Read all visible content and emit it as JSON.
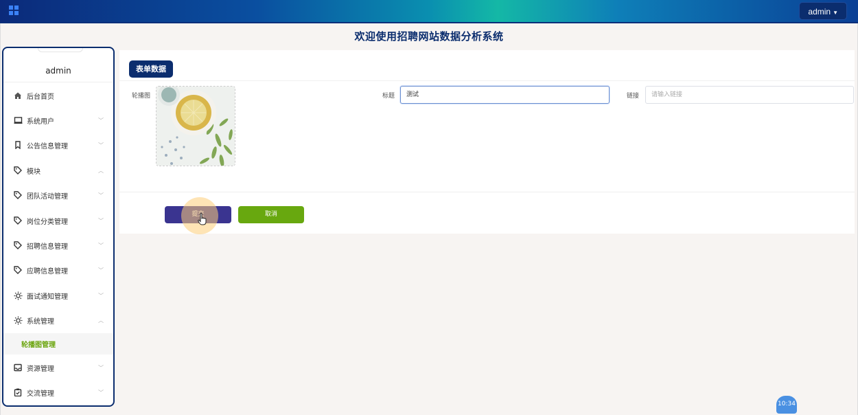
{
  "header": {
    "user_menu_label": "admin"
  },
  "site_title": "欢迎使用招聘网站数据分析系统",
  "sidebar": {
    "username": "admin",
    "items": [
      {
        "label": "后台首页",
        "icon": "home-icon"
      },
      {
        "label": "系统用户",
        "icon": "monitor-icon"
      },
      {
        "label": "公告信息管理",
        "icon": "bookmark-icon"
      },
      {
        "label": "模块",
        "icon": "tag-icon"
      },
      {
        "label": "团队活动管理",
        "icon": "tag-icon"
      },
      {
        "label": "岗位分类管理",
        "icon": "tag-icon"
      },
      {
        "label": "招聘信息管理",
        "icon": "tag-icon"
      },
      {
        "label": "应聘信息管理",
        "icon": "tag-icon"
      },
      {
        "label": "面试通知管理",
        "icon": "sun-icon"
      },
      {
        "label": "系统管理",
        "icon": "sun-icon"
      },
      {
        "label": "资源管理",
        "icon": "inbox-icon"
      },
      {
        "label": "交流管理",
        "icon": "clipboard-check-icon"
      }
    ],
    "submenu": {
      "label": "轮播图管理"
    }
  },
  "form": {
    "section_label": "表单数据",
    "carousel_label": "轮播图",
    "title_label": "标题",
    "title_value": "测试",
    "link_label": "链接",
    "link_placeholder": "请输入链接",
    "submit_label": "提交",
    "cancel_label": "取消"
  },
  "clock": "10:34",
  "colors": {
    "brand_dark": "#0b2d6e",
    "submit": "#3a3490",
    "cancel": "#68a80f",
    "active_submenu": "#6aa40c"
  }
}
